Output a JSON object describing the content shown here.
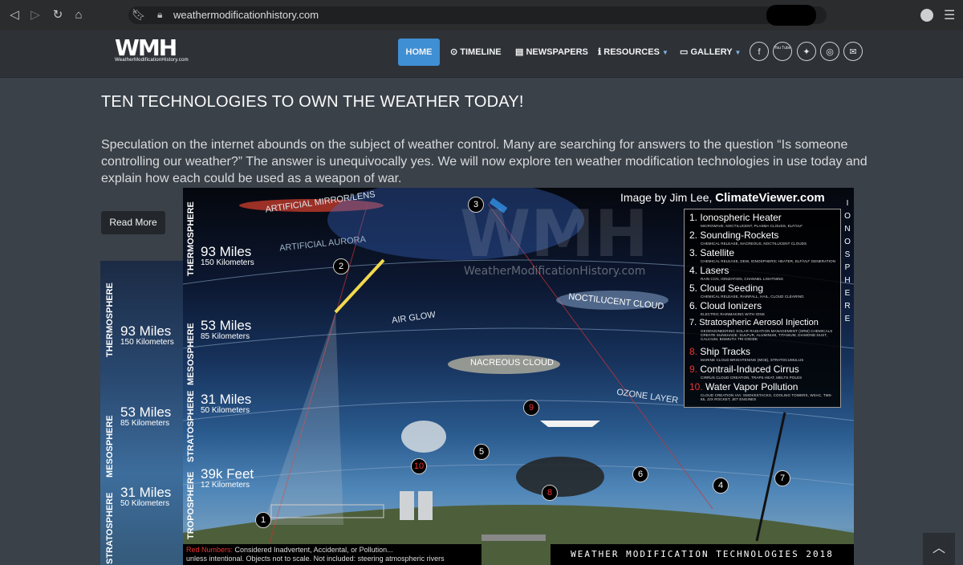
{
  "browser": {
    "url": "weathermodificationhistory.com"
  },
  "header": {
    "logo_mark": "WMH",
    "logo_sub": "WeatherModificationHistory.com",
    "nav": [
      {
        "label": "HOME",
        "icon": ""
      },
      {
        "label": "TIMELINE",
        "icon": "clock-icon"
      },
      {
        "label": "NEWSPAPERS",
        "icon": "newspaper-icon"
      },
      {
        "label": "RESOURCES",
        "icon": "info-icon"
      },
      {
        "label": "GALLERY",
        "icon": "monitor-icon"
      }
    ],
    "social": [
      "f",
      "You Tube",
      "twitter",
      "instagram",
      "mail"
    ],
    "accent": "#3f8fd4"
  },
  "article": {
    "title": "TEN TECHNOLOGIES TO OWN THE WEATHER TODAY!",
    "intro": "Speculation on the internet abounds on the subject of weather control. Many are searching for answers to the question “Is someone controlling our weather?” The answer is unequivocally yes. We will now explore ten weather modification technologies in use today and explain how each could be used as a weapon of war.",
    "read_more": "Read More"
  },
  "bg_poster": {
    "layers": [
      "THERMOSPHERE",
      "MESOSPHERE",
      "STRATOSPHERE"
    ],
    "altitudes": [
      {
        "miles": "93 Miles",
        "km": "150 Kilometers"
      },
      {
        "miles": "53 Miles",
        "km": "85 Kilometers"
      },
      {
        "miles": "31 Miles",
        "km": "50 Kilometers"
      }
    ]
  },
  "poster": {
    "credit_prefix": "Image by Jim Lee, ",
    "credit_name": "ClimateViewer.com",
    "watermark": "WMH",
    "watermark_sub": "WeatherModificationHistory.com",
    "side_label": "IONOSPHERE",
    "layers": [
      "THERMOSPHERE",
      "MESOSPHERE",
      "STRATOSPHERE",
      "TROPOSPHERE"
    ],
    "altitudes": [
      {
        "miles": "93 Miles",
        "km": "150 Kilometers"
      },
      {
        "miles": "53 Miles",
        "km": "85 Kilometers"
      },
      {
        "miles": "31 Miles",
        "km": "50 Kilometers"
      },
      {
        "miles": "39k Feet",
        "km": "12 Kilometers"
      }
    ],
    "sky_labels": [
      "ARTIFICIAL MIRROR/LENS",
      "ARTIFICIAL AURORA",
      "AIR GLOW",
      "NOCTILUCENT CLOUD",
      "NACREOUS CLOUD",
      "OZONE LAYER"
    ],
    "legend": [
      {
        "num": "1.",
        "name": "Ionospheric Heater",
        "sub": "MICROWAVE, NOCTILUCENT, PLASMA CLOUDS, ELF/VLF",
        "red": false
      },
      {
        "num": "2.",
        "name": "Sounding-Rockets",
        "sub": "CHEMICAL RELEASE, NACREOUS, NOCTILUCENT CLOUDS",
        "red": false
      },
      {
        "num": "3.",
        "name": "Satellite",
        "sub": "CHEMICAL RELEASE, DEW, IONOSPHERIC HEATER, ELF/VLF GENERATION",
        "red": false
      },
      {
        "num": "4.",
        "name": "Lasers",
        "sub": "RAIN CCN, IONIZATION, CHANNEL LIGHTNING",
        "red": false
      },
      {
        "num": "5.",
        "name": "Cloud Seeding",
        "sub": "CHEMICAL RELEASE, RAINFALL, HAIL, CLOUD CLEARING",
        "red": false
      },
      {
        "num": "6.",
        "name": "Cloud Ionizers",
        "sub": "ELECTRIC RAINMAKING WITH IONS",
        "red": false
      },
      {
        "num": "7.",
        "name": "Stratospheric Aerosol Injection",
        "sub": "GEOENGINEERING SOLAR RADIATION MANAGEMENT (SRM) CHEMICALS CREATE SUNSHADE: SULFUR, ALUMINUM, TITANIUM, DIAMOND DUST, CALCIUM, BISMUTH TRI-IODIDE",
        "red": false
      },
      {
        "num": "8.",
        "name": "Ship Tracks",
        "sub": "MARINE CLOUD BRIGHTENING (MCB), STRATOCUMULUS",
        "red": true
      },
      {
        "num": "9.",
        "name": "Contrail-Induced Cirrus",
        "sub": "CIRRUS CLOUD CREATION, TRAPS HEAT, MELTS POLES",
        "red": true
      },
      {
        "num": "10.",
        "name": "Water Vapor Pollution",
        "sub": "CLOUD CREATION VIA: SMOKESTACKS, COOLING TOWERS, WSAC, TMS-65, J2X ROCKET, JET ENGINES",
        "red": true
      }
    ],
    "badges": [
      "1",
      "2",
      "3",
      "4",
      "5",
      "6",
      "7",
      "8",
      "9",
      "10"
    ],
    "footer_red": "Red Numbers:",
    "footer_line1": " Considered Inadvertent, Accidental, or Pollution...",
    "footer_line2": "unless intentional.  Objects not to scale. Not included: steering atmospheric rivers",
    "footer_right": "WEATHER MODIFICATION TECHNOLOGIES 2018"
  }
}
